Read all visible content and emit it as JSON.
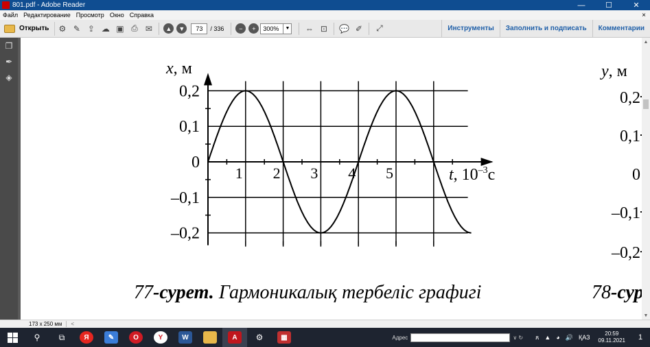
{
  "window": {
    "title": "801.pdf - Adobe Reader",
    "minimize": "—",
    "maximize": "☐",
    "close": "✕"
  },
  "menu": {
    "items": [
      "Файл",
      "Редактирование",
      "Просмотр",
      "Окно",
      "Справка"
    ],
    "close_doc": "×"
  },
  "toolbar": {
    "open_label": "Открыть",
    "page_current": "73",
    "page_total": "/ 336",
    "zoom": "300%",
    "tools_label": "Инструменты",
    "fill_sign_label": "Заполнить и подписать",
    "comments_label": "Комментарии"
  },
  "document": {
    "fig77": {
      "y_axis_label_var": "x",
      "y_axis_label_unit": ", м",
      "y_ticks": [
        "0,2",
        "0,1",
        "0",
        "–0,1",
        "–0,2"
      ],
      "x_ticks": [
        "1",
        "2",
        "3",
        "4",
        "5"
      ],
      "x_axis_label_var": "t",
      "x_axis_label_unit": ", 10",
      "x_axis_label_exp": "–3",
      "x_axis_label_tail": "с",
      "caption_num": "77",
      "caption_bold": "-сурет.",
      "caption_text": " Гармоникалық тербеліс графигі"
    },
    "fig78": {
      "y_axis_label_var": "y",
      "y_axis_label_unit": ", м",
      "y_ticks": [
        "0,2",
        "0,1",
        "0",
        "–0,1",
        "–0,2"
      ],
      "caption_num": "78",
      "caption_bold": "-сур"
    }
  },
  "chart_data": {
    "type": "line",
    "title": "",
    "xlabel": "t, 10⁻³с",
    "ylabel": "x, м",
    "x": [
      0,
      0.5,
      1,
      1.5,
      2,
      2.5,
      3,
      3.5,
      4,
      4.5,
      5,
      5.5,
      6,
      6.5
    ],
    "series": [
      {
        "values": [
          0,
          0.141,
          0.2,
          0.141,
          0,
          -0.141,
          -0.2,
          -0.141,
          0,
          0.141,
          0.2,
          0.141,
          0,
          -0.141
        ]
      }
    ],
    "xlim": [
      0,
      7
    ],
    "ylim": [
      -0.2,
      0.2
    ],
    "period": 4,
    "amplitude": 0.2,
    "curve_end_x": 7,
    "grid": true
  },
  "statusbar": {
    "page_size": "173 x 250 мм",
    "scroll_left": "<"
  },
  "taskbar": {
    "address_label": "Адрес",
    "address_value": "",
    "lang": "ҚАЗ",
    "time": "20:59",
    "date": "09.11.2021",
    "notification_count": "1"
  }
}
